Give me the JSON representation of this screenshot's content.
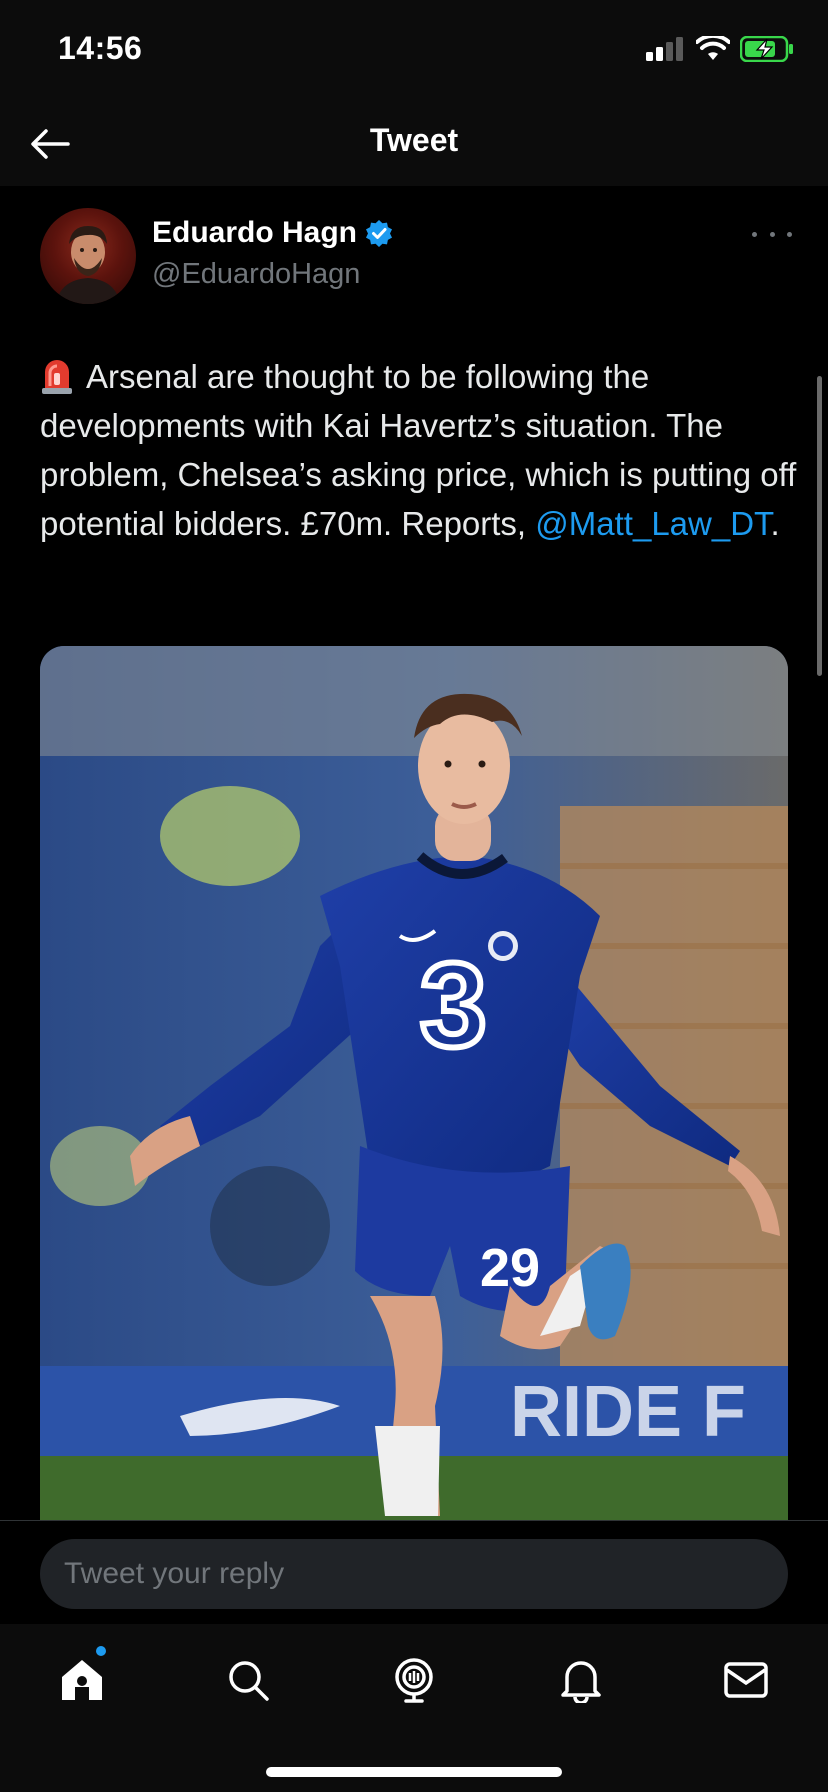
{
  "status_bar": {
    "time": "14:56"
  },
  "header": {
    "title": "Tweet"
  },
  "tweet": {
    "author_name": "Eduardo Hagn",
    "author_handle": "@EduardoHagn",
    "text_main": "Arsenal are thought to be following the developments with Kai Havertz’s situation. The problem, Chelsea’s asking price, which is putting off potential bidders. £70m. Reports, ",
    "mention": "@Matt_Law_DT",
    "text_tail": ".",
    "media": {
      "shirt_number": "29",
      "sponsor_number": "3"
    }
  },
  "reply": {
    "placeholder": "Tweet your reply"
  },
  "icons": {
    "back": "back-arrow-icon",
    "verified": "verified-badge-icon",
    "more": "more-icon",
    "alert": "siren-icon",
    "tabs": [
      "home-icon",
      "search-icon",
      "spaces-icon",
      "notifications-icon",
      "messages-icon"
    ]
  },
  "colors": {
    "accent": "#1d9bf0",
    "background": "#000000",
    "secondary_text": "#71767b"
  }
}
